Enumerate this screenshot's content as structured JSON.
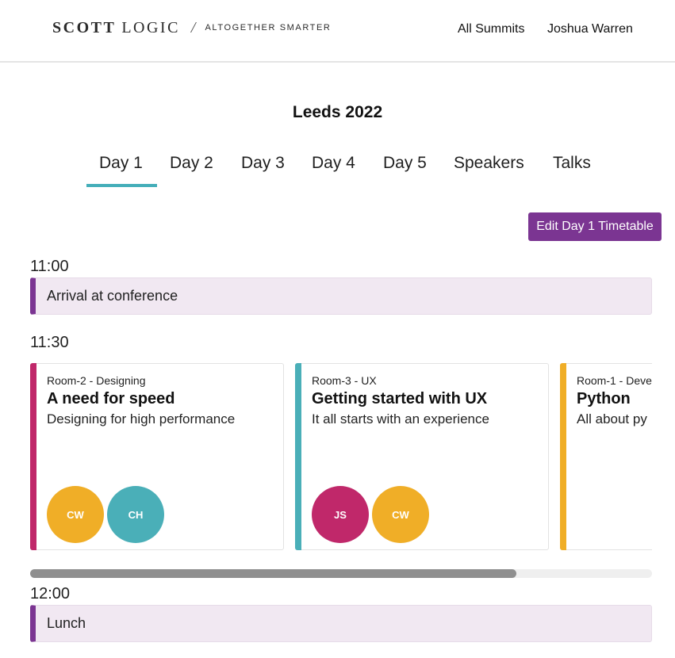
{
  "header": {
    "logo": {
      "primary": "SCOTT",
      "secondary": "LOGIC",
      "slash": "/",
      "tagline": "ALTOGETHER SMARTER"
    },
    "nav": {
      "all_summits": "All Summits",
      "user": "Joshua Warren"
    }
  },
  "summit_title": "Leeds 2022",
  "tabs": [
    {
      "label": "Day 1",
      "active": true
    },
    {
      "label": "Day 2"
    },
    {
      "label": "Day 3"
    },
    {
      "label": "Day 4"
    },
    {
      "label": "Day 5"
    },
    {
      "label": "Speakers"
    },
    {
      "label": "Talks"
    }
  ],
  "edit_button": "Edit Day 1 Timetable",
  "timetable": {
    "slot1": {
      "time": "11:00",
      "label": "Arrival at conference"
    },
    "slot2": {
      "time": "11:30",
      "talks": [
        {
          "room": "Room-2 - Designing",
          "title": "A need for speed",
          "subtitle": "Designing for high performance",
          "color": "#c0286a",
          "speakers": [
            {
              "initials": "CW",
              "color": "#f0ae27"
            },
            {
              "initials": "CH",
              "color": "#4aafb8"
            }
          ]
        },
        {
          "room": "Room-3 - UX",
          "title": "Getting started with UX",
          "subtitle": "It all starts with an experience",
          "color": "#4aafb8",
          "speakers": [
            {
              "initials": "JS",
              "color": "#c0286a"
            },
            {
              "initials": "CW",
              "color": "#f0ae27"
            }
          ]
        },
        {
          "room": "Room-1 - Deve",
          "title": "Python",
          "subtitle": "All about py",
          "color": "#f0ae27",
          "speakers": []
        }
      ]
    },
    "slot3": {
      "time": "12:00",
      "label": "Lunch"
    }
  },
  "colors": {
    "accent_purple": "#7b3592",
    "tab_underline": "#45aeb9",
    "break_bg": "#f1e8f2"
  }
}
